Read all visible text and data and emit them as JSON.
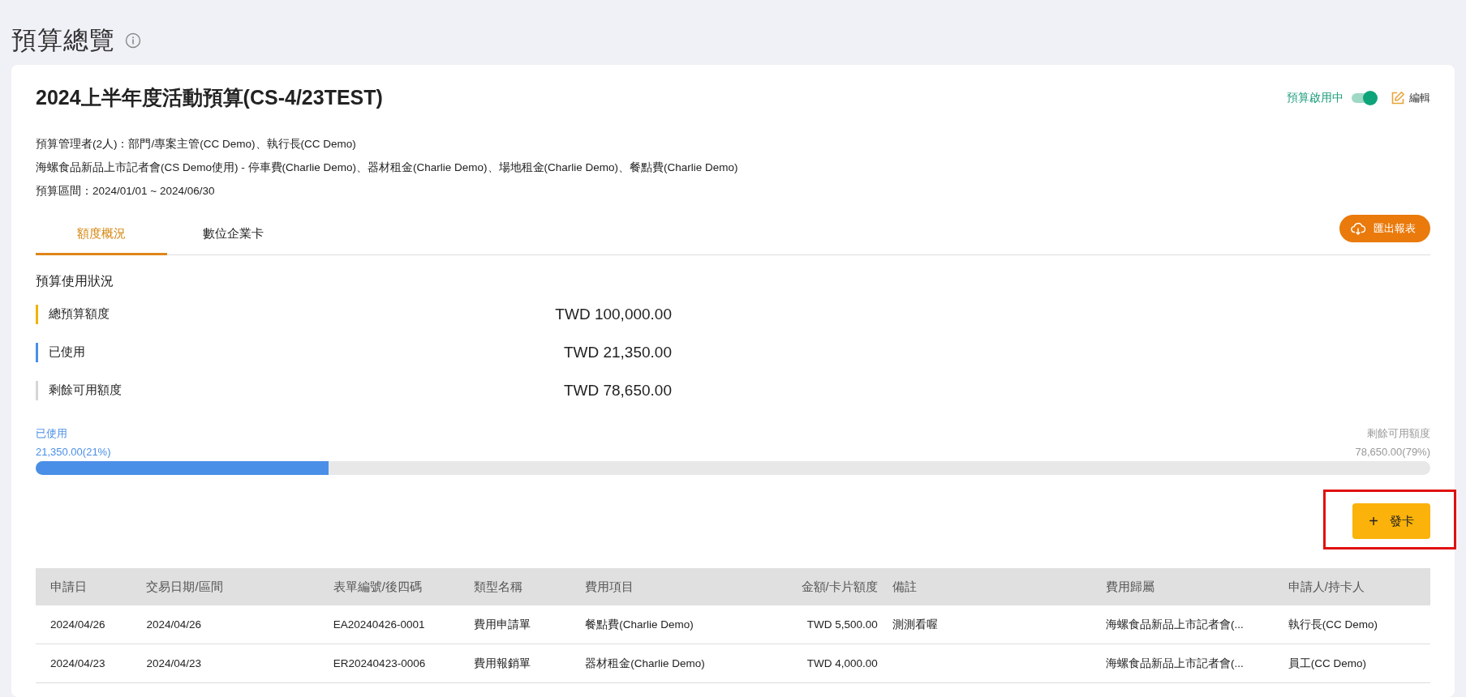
{
  "page": {
    "title": "預算總覽"
  },
  "budget": {
    "title": "2024上半年度活動預算(CS-4/23TEST)",
    "status": {
      "label": "預算啟用中",
      "on": true
    },
    "edit": {
      "label": "編輯"
    },
    "details": [
      "預算管理者(2人)：部門/專案主管(CC Demo)、執行長(CC Demo)",
      "海螺食品新品上市記者會(CS Demo使用) - 停車費(Charlie Demo)、器材租金(Charlie Demo)、場地租金(Charlie Demo)、餐點費(Charlie Demo)",
      "預算區間：2024/01/01 ~ 2024/06/30"
    ]
  },
  "tabs": [
    {
      "label": "額度概況",
      "selected": true
    },
    {
      "label": "數位企業卡",
      "selected": false
    }
  ],
  "export_button": {
    "label": "匯出報表"
  },
  "usage": {
    "title": "預算使用狀況",
    "items": [
      {
        "label": "總預算額度",
        "amount": "TWD 100,000.00",
        "color": "#f0b400"
      },
      {
        "label": "已使用",
        "amount": "TWD 21,350.00",
        "color": "#4a8fe7"
      },
      {
        "label": "剩餘可用額度",
        "amount": "TWD 78,650.00",
        "color": "#d6d6d6"
      }
    ],
    "bar": {
      "used_label": "已使用",
      "used_value": "21,350.00(21%)",
      "remaining_label": "剩餘可用額度",
      "remaining_value": "78,650.00(79%)",
      "level": 0.21
    }
  },
  "issue_card_button": {
    "icon": "+",
    "label": "發卡",
    "highlighted": true
  },
  "table": {
    "columns": [
      "申請日",
      "交易日期/區間",
      "表單編號/後四碼",
      "類型名稱",
      "費用項目",
      "金額/卡片額度",
      "備註",
      "費用歸屬",
      "申請人/持卡人"
    ],
    "rows": [
      [
        "2024/04/26",
        "2024/04/26",
        "EA20240426-0001",
        "費用申請單",
        "餐點費(Charlie Demo)",
        "TWD 5,500.00",
        "測測看喔",
        "海螺食品新品上市記者會(...",
        "執行長(CC Demo)"
      ],
      [
        "2024/04/23",
        "2024/04/23",
        "ER20240423-0006",
        "費用報銷單",
        "器材租金(Charlie Demo)",
        "TWD 4,000.00",
        "",
        "海螺食品新品上市記者會(...",
        "員工(CC Demo)"
      ]
    ]
  }
}
